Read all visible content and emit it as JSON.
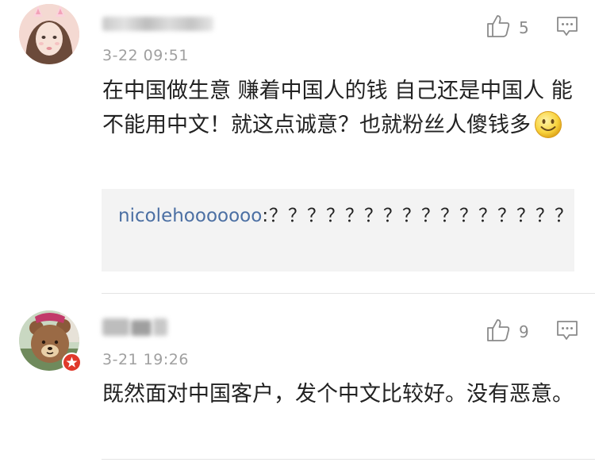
{
  "comments": [
    {
      "time": "3-22 09:51",
      "likes": "5",
      "content": "在中国做生意 赚着中国人的钱 自己还是中国人 能不能用中文！就这点诚意？也就粉丝人傻钱多",
      "reply": {
        "user": "nicolehooooooo",
        "text": ":？？？？？？？？？？？？？？？？"
      }
    },
    {
      "time": "3-21 19:26",
      "likes": "9",
      "content": "既然面对中国客户，发个中文比较好。没有恶意。"
    }
  ],
  "icons": {
    "like": "thumbs-up-icon",
    "reply": "comment-bubble-icon",
    "emoji": "smiley-icon",
    "badge": "badge-icon"
  },
  "colors": {
    "username_link": "#4b6fa3",
    "timestamp": "#a0a0a0",
    "reply_background": "#f3f3f3",
    "badge_red": "#e0392b"
  }
}
